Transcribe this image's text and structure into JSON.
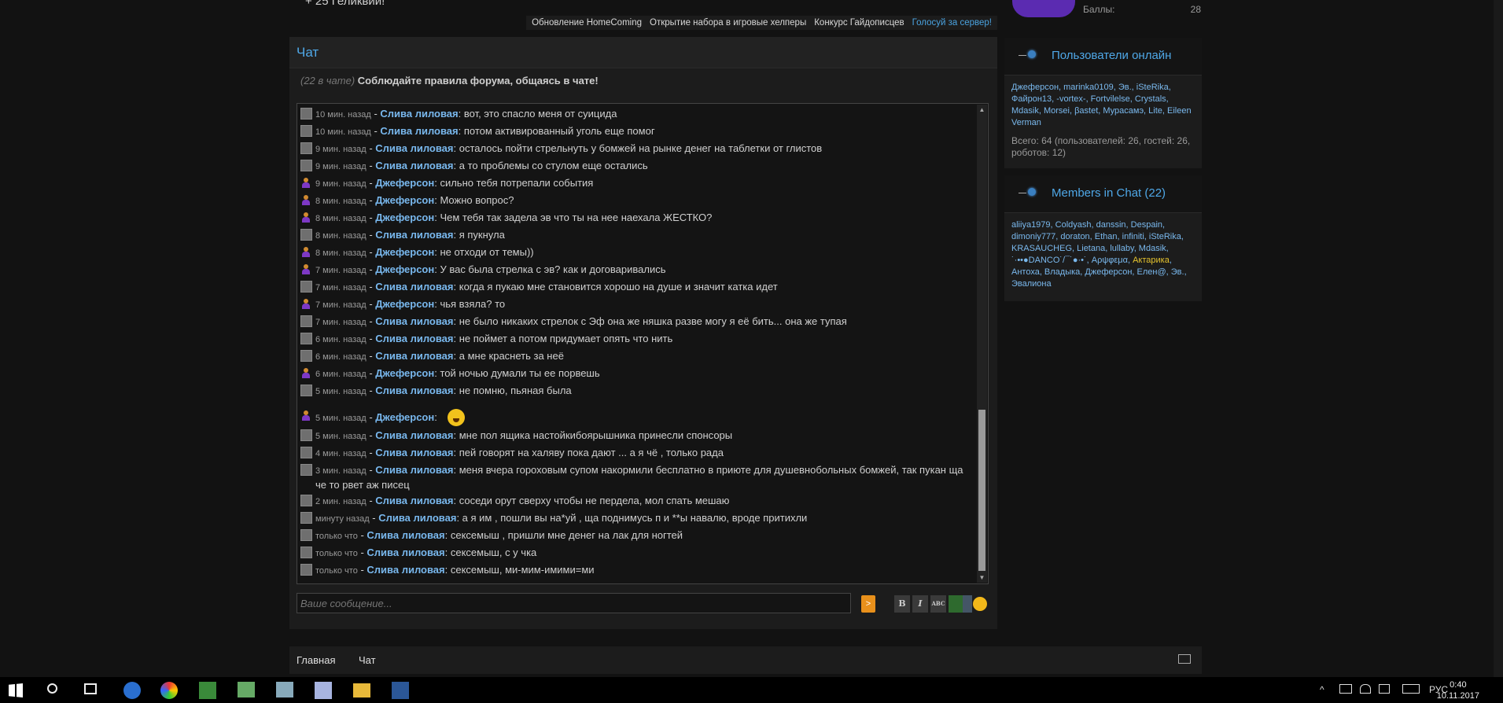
{
  "top": {
    "partial_text": "+ 25 Геликвии!",
    "links": [
      "Обновление HomeComing",
      "Открытие набора в игровые хелперы",
      "Конкурс Гайдописцев",
      "Голосуй за сервер!"
    ]
  },
  "profile": {
    "points_label": "Баллы:",
    "points_value": "28"
  },
  "chat": {
    "title": "Чат",
    "in_chat": "(22 в чате)",
    "rules": "Соблюдайте правила форума, общаясь в чате!",
    "messages": [
      {
        "time": "10 мин. назад",
        "name": "Слива лиловая",
        "text": "вот, это спасло меня от суицида",
        "j": false
      },
      {
        "time": "10 мин. назад",
        "name": "Слива лиловая",
        "text": "потом активированный уголь еще помог",
        "j": false
      },
      {
        "time": "9 мин. назад",
        "name": "Слива лиловая",
        "text": "осталось пойти стрельнуть у бомжей на рынке денег на таблетки от глистов",
        "j": false
      },
      {
        "time": "9 мин. назад",
        "name": "Слива лиловая",
        "text": "а то проблемы со стулом еще остались",
        "j": false
      },
      {
        "time": "9 мин. назад",
        "name": "Джеферсон",
        "text": "сильно тебя потрепали события",
        "j": true
      },
      {
        "time": "8 мин. назад",
        "name": "Джеферсон",
        "text": "Можно вопрос?",
        "j": true
      },
      {
        "time": "8 мин. назад",
        "name": "Джеферсон",
        "text": "Чем тебя так задела эв что ты на нее наехала ЖЕСТКО?",
        "j": true
      },
      {
        "time": "8 мин. назад",
        "name": "Слива лиловая",
        "text": "я пукнула",
        "j": false
      },
      {
        "time": "8 мин. назад",
        "name": "Джеферсон",
        "text": "не отходи от темы))",
        "j": true
      },
      {
        "time": "7 мин. назад",
        "name": "Джеферсон",
        "text": "У вас была стрелка с эв? как и договаривались",
        "j": true
      },
      {
        "time": "7 мин. назад",
        "name": "Слива лиловая",
        "text": "когда я пукаю мне становится хорошо на душе и значит катка идет",
        "j": false
      },
      {
        "time": "7 мин. назад",
        "name": "Джеферсон",
        "text": "чья взяла? то",
        "j": true
      },
      {
        "time": "7 мин. назад",
        "name": "Слива лиловая",
        "text": "не было никаких стрелок с Эф она же няшка разве могу я её бить... она же тупая",
        "j": false
      },
      {
        "time": "6 мин. назад",
        "name": "Слива лиловая",
        "text": "не поймет а потом придумает опять что нить",
        "j": false
      },
      {
        "time": "6 мин. назад",
        "name": "Слива лиловая",
        "text": "а мне краснеть за неё",
        "j": false
      },
      {
        "time": "6 мин. назад",
        "name": "Джеферсон",
        "text": "той ночью думали ты ее порвешь",
        "j": true
      },
      {
        "time": "5 мин. назад",
        "name": "Слива лиловая",
        "text": "не помню, пьяная была",
        "j": false
      },
      {
        "time": "5 мин. назад",
        "name": "Джеферсон",
        "text": "",
        "j": true,
        "emoji": true
      },
      {
        "time": "5 мин. назад",
        "name": "Слива лиловая",
        "text": "мне пол ящика настойкибоярышника принесли спонсоры",
        "j": false
      },
      {
        "time": "4 мин. назад",
        "name": "Слива лиловая",
        "text": "пей говорят на халяву пока дают ... а я чё , только рада",
        "j": false
      },
      {
        "time": "3 мин. назад",
        "name": "Слива лиловая",
        "text": "меня вчера гороховым супом накормили бесплатно в приюте для душевнобольных бомжей, так пукан ща че то рвет аж писец",
        "j": false
      },
      {
        "time": "2 мин. назад",
        "name": "Слива лиловая",
        "text": "соседи орут сверху чтобы не пердела, мол спать мешаю",
        "j": false
      },
      {
        "time": "минуту назад",
        "name": "Слива лиловая",
        "text": "а я им , пошли вы на*уй , ща поднимусь п и **ы навалю, вроде притихли",
        "j": false
      },
      {
        "time": "только что",
        "name": "Слива лиловая",
        "text": "сексемыш , пришли мне денег на лак для ногтей",
        "j": false
      },
      {
        "time": "только что",
        "name": "Слива лиловая",
        "text": "сексемыш, с у чка",
        "j": false
      },
      {
        "time": "только что",
        "name": "Слива лиловая",
        "text": "сексемыш, ми-мим-имими=ми",
        "j": false
      }
    ],
    "input_placeholder": "Ваше сообщение...",
    "send_label": ">",
    "fmt": [
      "B",
      "I",
      "ABC"
    ]
  },
  "online": {
    "title": "Пользователи онлайн",
    "names": "Джеферсон, marinka0109, Эв., iSteRika, Файрон13, -vortex-, Fortvilelse, Crystals, Mdasik, Morsei, βastet, Мурасамэ, Lite, Eileen Verman",
    "total": "Всего: 64 (пользователей: 26, гостей: 26, роботов: 12)"
  },
  "members": {
    "title": "Members in Chat (22)",
    "names_before": "aliiya1979, Coldyash, danssin, Despain, dimoniy777, doraton, Ethan, infiniti, iSteRika, KRASAUCHEG, Lietana, lullaby, Mdasik, ˙·••●DANCO˙/¯˙●·•˙, Αρψφεμα,",
    "highlight": "Актарика",
    "names_after": ", Антоха, Владыка, Джеферсон, Елен@, Эв., Эвалиона"
  },
  "footer": {
    "home": "Главная",
    "chat": "Чат"
  },
  "taskbar": {
    "lang": "РУС",
    "time": "0:40",
    "date": "10.11.2017"
  }
}
